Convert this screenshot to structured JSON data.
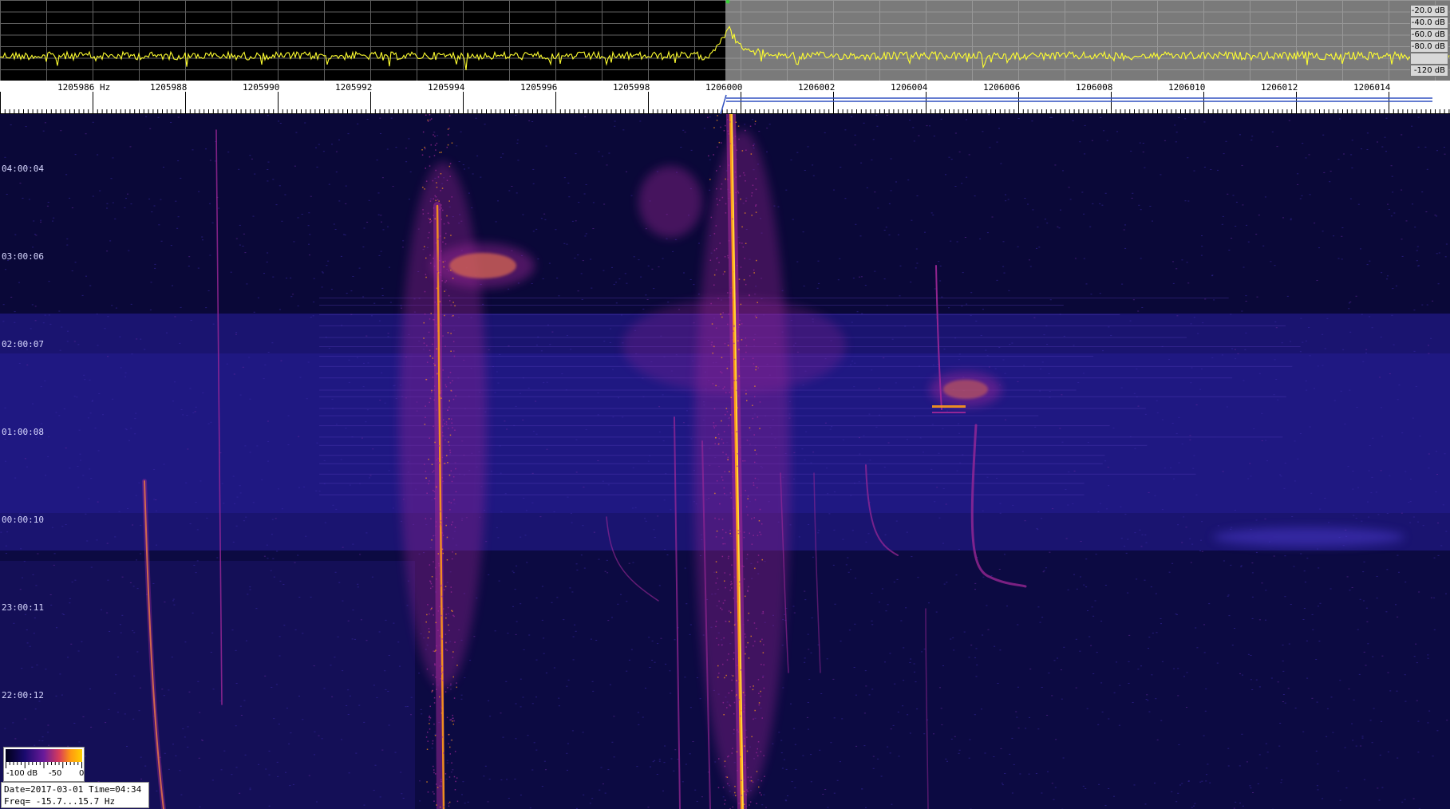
{
  "spectrum": {
    "db_labels": [
      "-20.0 dB",
      "-40.0 dB",
      "-60.0 dB",
      "-80.0 dB",
      "",
      "-120 dB"
    ],
    "trace_color": "#ffff30",
    "grid_color": "#b0b0b0"
  },
  "frequency_axis": {
    "unit_label": "1205986 Hz",
    "labels": [
      "1205988",
      "1205990",
      "1205992",
      "1205994",
      "1205996",
      "1205998",
      "1206000",
      "1206002",
      "1206004",
      "1206006",
      "1206008",
      "1206010",
      "1206012",
      "1206014"
    ]
  },
  "waterfall": {
    "time_labels": [
      "04:00:04",
      "03:00:06",
      "02:00:07",
      "01:00:08",
      "00:00:10",
      "23:00:11",
      "22:00:12"
    ],
    "colors": {
      "background": "#050528",
      "low": "#2a1480",
      "mid": "#a02898",
      "high": "#ff9a18",
      "peak": "#ffe040"
    }
  },
  "colorbar": {
    "min_label": "-100 dB",
    "mid_label": "-50",
    "max_label": "0"
  },
  "info": {
    "datetime": "Date=2017-03-01 Time=04:34",
    "freq_range": "Freq= -15.7...15.7 Hz"
  }
}
